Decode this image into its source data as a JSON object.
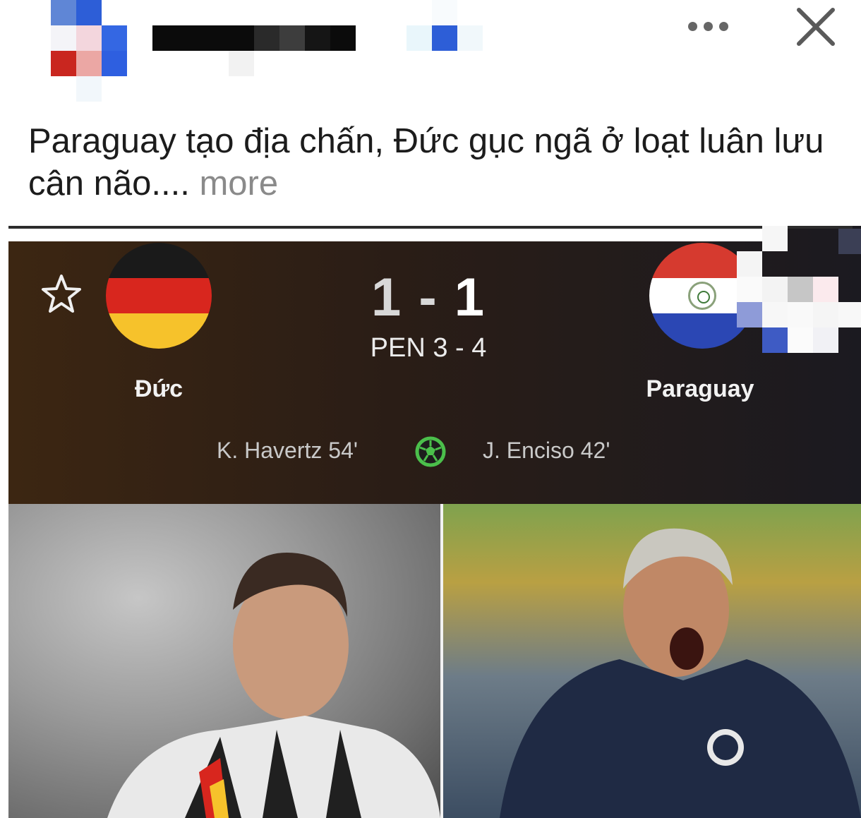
{
  "header": {
    "more_icon": "more-horizontal-icon",
    "close_icon": "close-icon"
  },
  "post": {
    "caption_text": "Paraguay tạo địa chấn, Đức gục ngã ở loạt luân lưu cân não.... ",
    "more_label": "more"
  },
  "scorecard": {
    "favorite_icon": "star-icon",
    "home_team": "Đức",
    "away_team": "Paraguay",
    "score_home": "1",
    "score_sep": " - ",
    "score_away": "1",
    "penalties": "PEN 3 - 4",
    "home_scorer": "K. Havertz 54'",
    "away_scorer": "J. Enciso 42'",
    "goal_icon": "soccer-ball-icon"
  },
  "colors": {
    "germany": [
      "#1a1a1a",
      "#d8261e",
      "#f6c22b"
    ],
    "paraguay": [
      "#d63a2f",
      "#ffffff",
      "#2b47b4"
    ],
    "goal_icon": "#4bbf4b"
  }
}
